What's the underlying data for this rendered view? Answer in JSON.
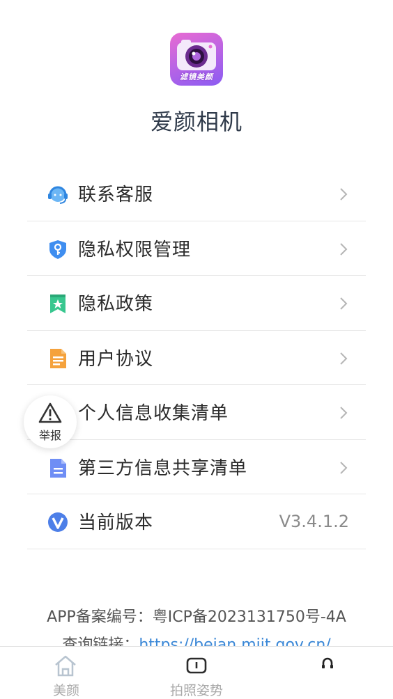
{
  "app": {
    "logo_text": "滤镜美颜",
    "name": "爱颜相机"
  },
  "menu": [
    {
      "label": "联系客服",
      "icon": "headset-icon",
      "value": ""
    },
    {
      "label": "隐私权限管理",
      "icon": "privacy-shield-icon",
      "value": ""
    },
    {
      "label": "隐私政策",
      "icon": "bookmark-star-icon",
      "value": ""
    },
    {
      "label": "用户协议",
      "icon": "document-icon",
      "value": ""
    },
    {
      "label": "个人信息收集清单",
      "icon": "info-collect-icon",
      "value": ""
    },
    {
      "label": "第三方信息共享清单",
      "icon": "share-list-icon",
      "value": ""
    },
    {
      "label": "当前版本",
      "icon": "version-v-icon",
      "value": "V3.4.1.2"
    }
  ],
  "report": {
    "label": "举报"
  },
  "footer": {
    "icp": "APP备案编号：粤ICP备2023131750号-4A",
    "query_label": "查询链接：",
    "query_link": "https://beian.miit.gov.cn/"
  },
  "tabs": [
    {
      "label": "美颜",
      "icon": "home-icon",
      "selected": false
    },
    {
      "label": "拍照姿势",
      "icon": "pose-icon",
      "selected": false
    },
    {
      "label": "",
      "icon": "headphone-icon",
      "selected": true
    }
  ],
  "colors": {
    "accent": "#4a90e2",
    "link": "#3a87d6",
    "tab_inactive": "#aaaaaa",
    "logo_gradient_start": "#e86bd2",
    "logo_gradient_end": "#8b5cf2"
  }
}
